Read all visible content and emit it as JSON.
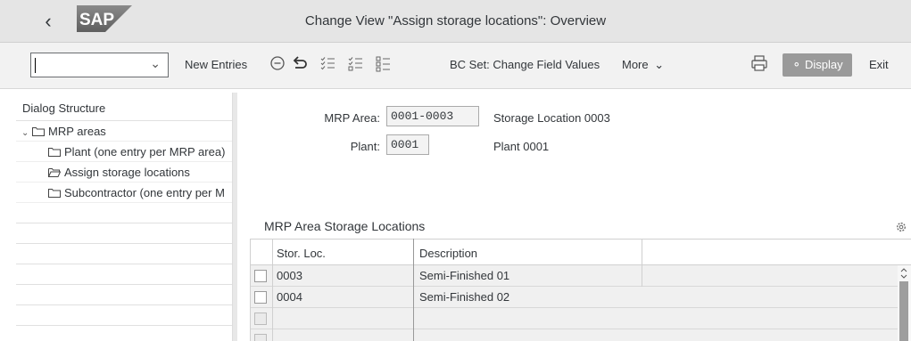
{
  "header": {
    "title": "Change View \"Assign storage locations\": Overview",
    "logo_text": "SAP"
  },
  "toolbar": {
    "command_field_value": "",
    "new_entries": "New Entries",
    "bc_set": "BC Set: Change Field Values",
    "more": "More",
    "display": "Display",
    "exit": "Exit"
  },
  "dialog": {
    "heading": "Dialog Structure",
    "items": [
      {
        "label": "MRP areas"
      },
      {
        "label": "Plant (one entry per MRP area)"
      },
      {
        "label": "Assign storage locations"
      },
      {
        "label": "Subcontractor (one entry per M"
      }
    ]
  },
  "header_fields": {
    "mrp_area_label": "MRP Area:",
    "mrp_area_value": "0001-0003",
    "mrp_area_desc": "Storage Location 0003",
    "plant_label": "Plant:",
    "plant_value": "0001",
    "plant_desc": "Plant 0001"
  },
  "table": {
    "title": "MRP Area Storage Locations",
    "columns": [
      "Stor. Loc.",
      "Description"
    ],
    "rows": [
      {
        "stor_loc": "0003",
        "description": "Semi-Finished 01"
      },
      {
        "stor_loc": "0004",
        "description": "Semi-Finished 02"
      },
      {
        "stor_loc": "",
        "description": ""
      },
      {
        "stor_loc": "",
        "description": ""
      }
    ]
  },
  "icons": [
    "back-icon",
    "chevron-down-icon",
    "minus-circle-icon",
    "undo-icon",
    "select-all-icon",
    "deselect-all-icon",
    "select-block-icon",
    "print-icon",
    "glasses-icon",
    "settings-icon",
    "folder-icon",
    "folder-open-icon",
    "expand-icon"
  ]
}
